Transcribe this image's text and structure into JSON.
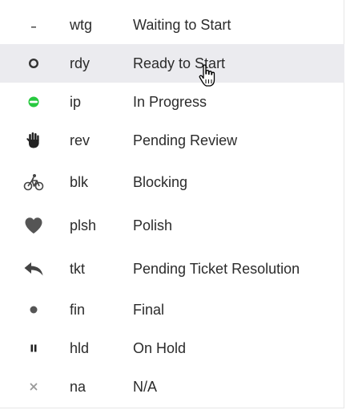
{
  "statuses": [
    {
      "code": "wtg",
      "label": "Waiting to Start",
      "icon": "dash-icon"
    },
    {
      "code": "rdy",
      "label": "Ready to Start",
      "icon": "ring-icon"
    },
    {
      "code": "ip",
      "label": "In Progress",
      "icon": "half-circle-icon"
    },
    {
      "code": "rev",
      "label": "Pending Review",
      "icon": "hand-icon"
    },
    {
      "code": "blk",
      "label": "Blocking",
      "icon": "bicycle-icon"
    },
    {
      "code": "plsh",
      "label": "Polish",
      "icon": "heart-icon"
    },
    {
      "code": "tkt",
      "label": "Pending Ticket Resolution",
      "icon": "reply-arrow-icon"
    },
    {
      "code": "fin",
      "label": "Final",
      "icon": "dot-icon"
    },
    {
      "code": "hld",
      "label": "On Hold",
      "icon": "pause-icon"
    },
    {
      "code": "na",
      "label": "N/A",
      "icon": "x-icon"
    }
  ],
  "hovered_code": "rdy",
  "colors": {
    "hover_background": "#ebebef",
    "text": "#2b2b2b",
    "in_progress_green": "#27c93f",
    "icon_dark": "#222222",
    "icon_gray": "#555555"
  }
}
